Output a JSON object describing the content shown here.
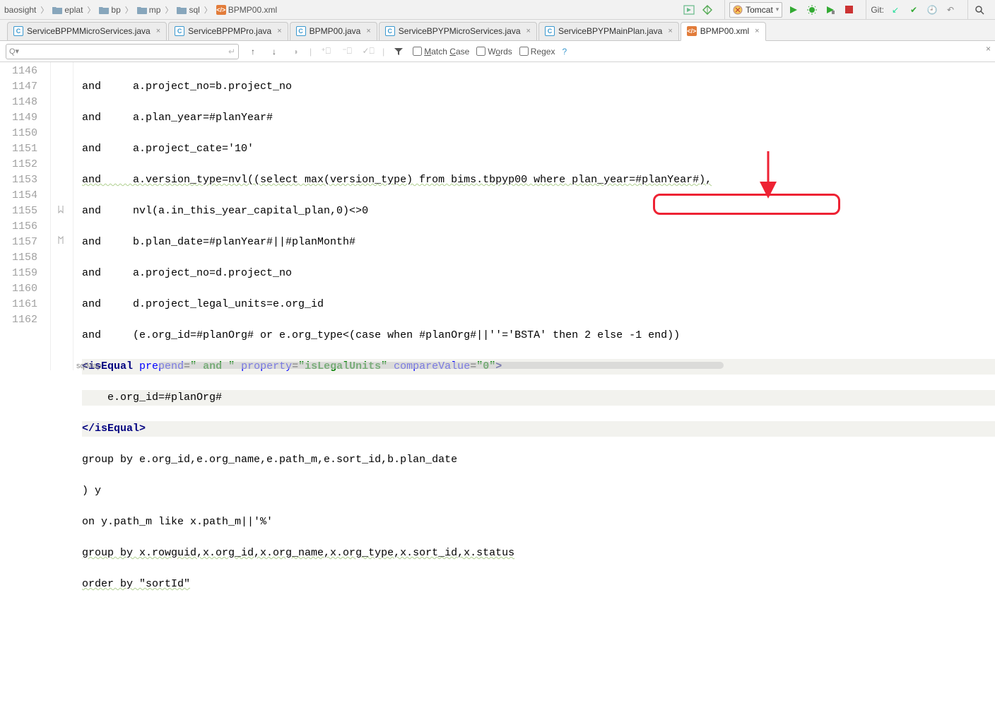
{
  "breadcrumbs": [
    "baosight",
    "eplat",
    "bp",
    "mp",
    "sql",
    "BPMP00.xml"
  ],
  "run_config": "Tomcat",
  "git_label": "Git:",
  "tabs": [
    {
      "label": "ServiceBPPMMicroServices.java",
      "type": "java",
      "active": false
    },
    {
      "label": "ServiceBPPMPro.java",
      "type": "java",
      "active": false
    },
    {
      "label": "BPMP00.java",
      "type": "java",
      "active": false
    },
    {
      "label": "ServiceBPYPMicroServices.java",
      "type": "java",
      "active": false
    },
    {
      "label": "ServiceBPYPMainPlan.java",
      "type": "java",
      "active": false
    },
    {
      "label": "BPMP00.xml",
      "type": "xml",
      "active": true
    }
  ],
  "find": {
    "prefix": "Q▾",
    "enter_hint": "↵",
    "match_case": "Match Case",
    "words": "Words",
    "regex": "Regex",
    "help": "?"
  },
  "gutter_start": 1146,
  "gutter_count": 17,
  "code": {
    "l1146": "and     a.project_no=b.project_no",
    "l1147": "and     a.plan_year=#planYear#",
    "l1148": "and     a.project_cate='10'",
    "l1149": "and     a.version_type=nvl((select max(version_type) from bims.tbpyp00 where plan_year=#planYear#),",
    "l1150": "and     nvl(a.in_this_year_capital_plan,0)<>0",
    "l1151": "and     b.plan_date=#planYear#||#planMonth#",
    "l1152": "and     a.project_no=d.project_no",
    "l1153": "and     d.project_legal_units=e.org_id",
    "l1154": "and     (e.org_id=#planOrg# or e.org_type<(case when #planOrg#||''='BSTA' then 2 else -1 end))",
    "l1155_open": "<isEqual",
    "l1155_attr1": "prepend",
    "l1155_val1": "\" and \"",
    "l1155_attr2": "property",
    "l1155_val2": "\"isLegalUnits\"",
    "l1155_attr3": "compareValue",
    "l1155_val3": "\"0\"",
    "l1155_close": ">",
    "l1156": "    e.org_id=#planOrg#",
    "l1157": "</isEqual>",
    "l1158": "group by e.org_id,e.org_name,e.path_m,e.sort_id,b.plan_date",
    "l1159": ") y",
    "l1160": "on y.path_m like x.path_m||'%'",
    "l1161": "group by x.rowguid,x.org_id,x.org_name,x.org_type,x.sort_id,x.status",
    "l1162": "order by \"sortId\""
  },
  "footer_hint": "sqlMap"
}
